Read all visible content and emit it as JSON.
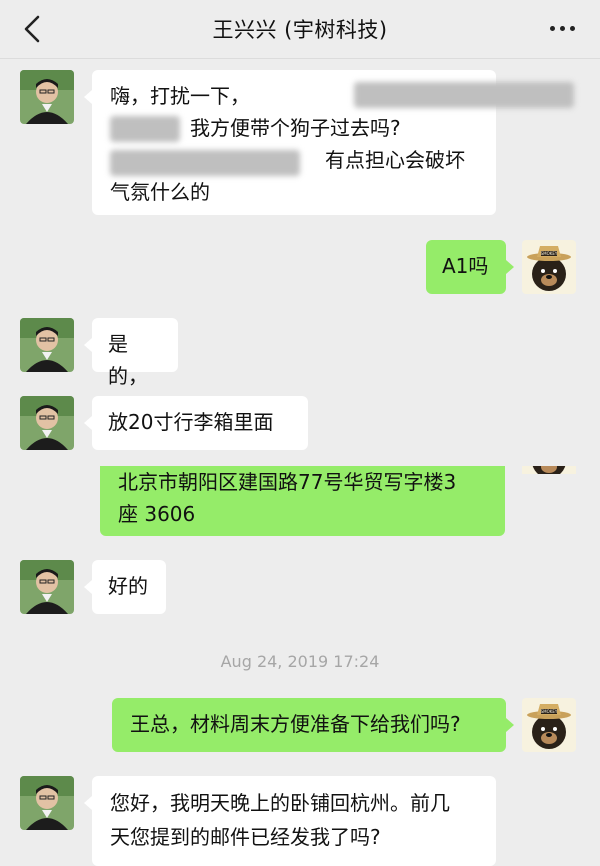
{
  "header": {
    "title": "王兴兴 (宇树科技)"
  },
  "messages": [
    {
      "from": "contact",
      "lines": [
        "嗨，打扰一下，",
        "我方便带个狗子过去吗?",
        "有点担心会破坏",
        "气氛什么的"
      ]
    },
    {
      "from": "me",
      "text": "A1吗"
    },
    {
      "from": "contact",
      "text": "是的，"
    },
    {
      "from": "contact",
      "text": "放20寸行李箱里面"
    },
    {
      "from": "me",
      "lines": [
        "北京市朝阳区建国路77号华贸写字楼3",
        "座 3606"
      ]
    },
    {
      "from": "contact",
      "text": "好的"
    },
    {
      "from": "me",
      "text": "王总，材料周末方便准备下给我们吗?"
    },
    {
      "from": "contact",
      "lines": [
        "您好，我明天晚上的卧铺回杭州。前几",
        "天您提到的邮件已经发我了吗?"
      ]
    }
  ],
  "timestamp": "Aug 24, 2019 17:24",
  "avatars": {
    "contact_icon": "contact-avatar-icon",
    "me_icon": "smokey-bear-avatar-icon"
  }
}
